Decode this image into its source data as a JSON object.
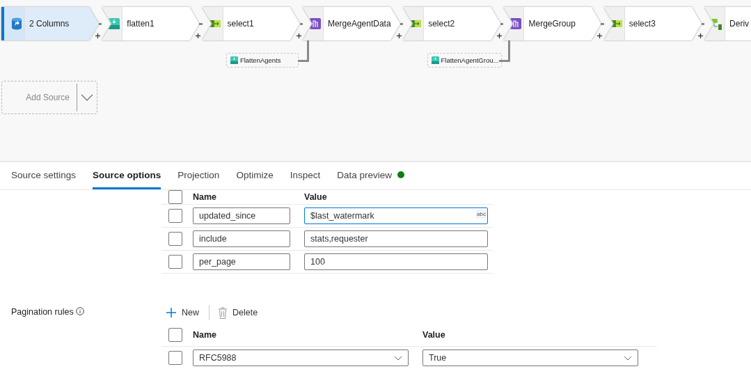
{
  "canvas": {
    "nodes": [
      {
        "kind": "source",
        "label": "2 Columns",
        "selected": true
      },
      {
        "kind": "flatten",
        "label": "flatten1",
        "selected": false
      },
      {
        "kind": "select",
        "label": "select1",
        "selected": false
      },
      {
        "kind": "join",
        "label": "MergeAgentData",
        "selected": false
      },
      {
        "kind": "select",
        "label": "select2",
        "selected": false
      },
      {
        "kind": "join",
        "label": "MergeGroup",
        "selected": false
      },
      {
        "kind": "select",
        "label": "select3",
        "selected": false
      },
      {
        "kind": "derive",
        "label": "Deriv",
        "selected": false
      }
    ],
    "branches": [
      {
        "kind": "flatten",
        "label": "FlattenAgents"
      },
      {
        "kind": "flatten",
        "label": "FlattenAgentGrou..."
      }
    ],
    "add_source": {
      "label": "Add Source"
    }
  },
  "tabs": [
    {
      "label": "Source settings",
      "selected": false,
      "dot": false
    },
    {
      "label": "Source options",
      "selected": true,
      "dot": false
    },
    {
      "label": "Projection",
      "selected": false,
      "dot": false
    },
    {
      "label": "Optimize",
      "selected": false,
      "dot": false
    },
    {
      "label": "Inspect",
      "selected": false,
      "dot": false
    },
    {
      "label": "Data preview",
      "selected": false,
      "dot": true
    }
  ],
  "parameters": {
    "columns": [
      "Name",
      "Value"
    ],
    "all_checked": false,
    "rows": [
      {
        "checked": false,
        "name": "updated_since",
        "value": "$last_watermark",
        "focused": true,
        "badge": "abc"
      },
      {
        "checked": false,
        "name": "include",
        "value": "stats,requester",
        "focused": false
      },
      {
        "checked": false,
        "name": "per_page",
        "value": "100",
        "focused": false
      }
    ]
  },
  "pagination": {
    "label": "Pagination rules",
    "toolbar": [
      {
        "kind": "add",
        "label": "New"
      },
      {
        "kind": "delete",
        "label": "Delete"
      }
    ],
    "columns": [
      "Name",
      "Value"
    ],
    "all_checked": false,
    "rows": [
      {
        "checked": false,
        "name": "RFC5988",
        "value": "True"
      }
    ]
  }
}
